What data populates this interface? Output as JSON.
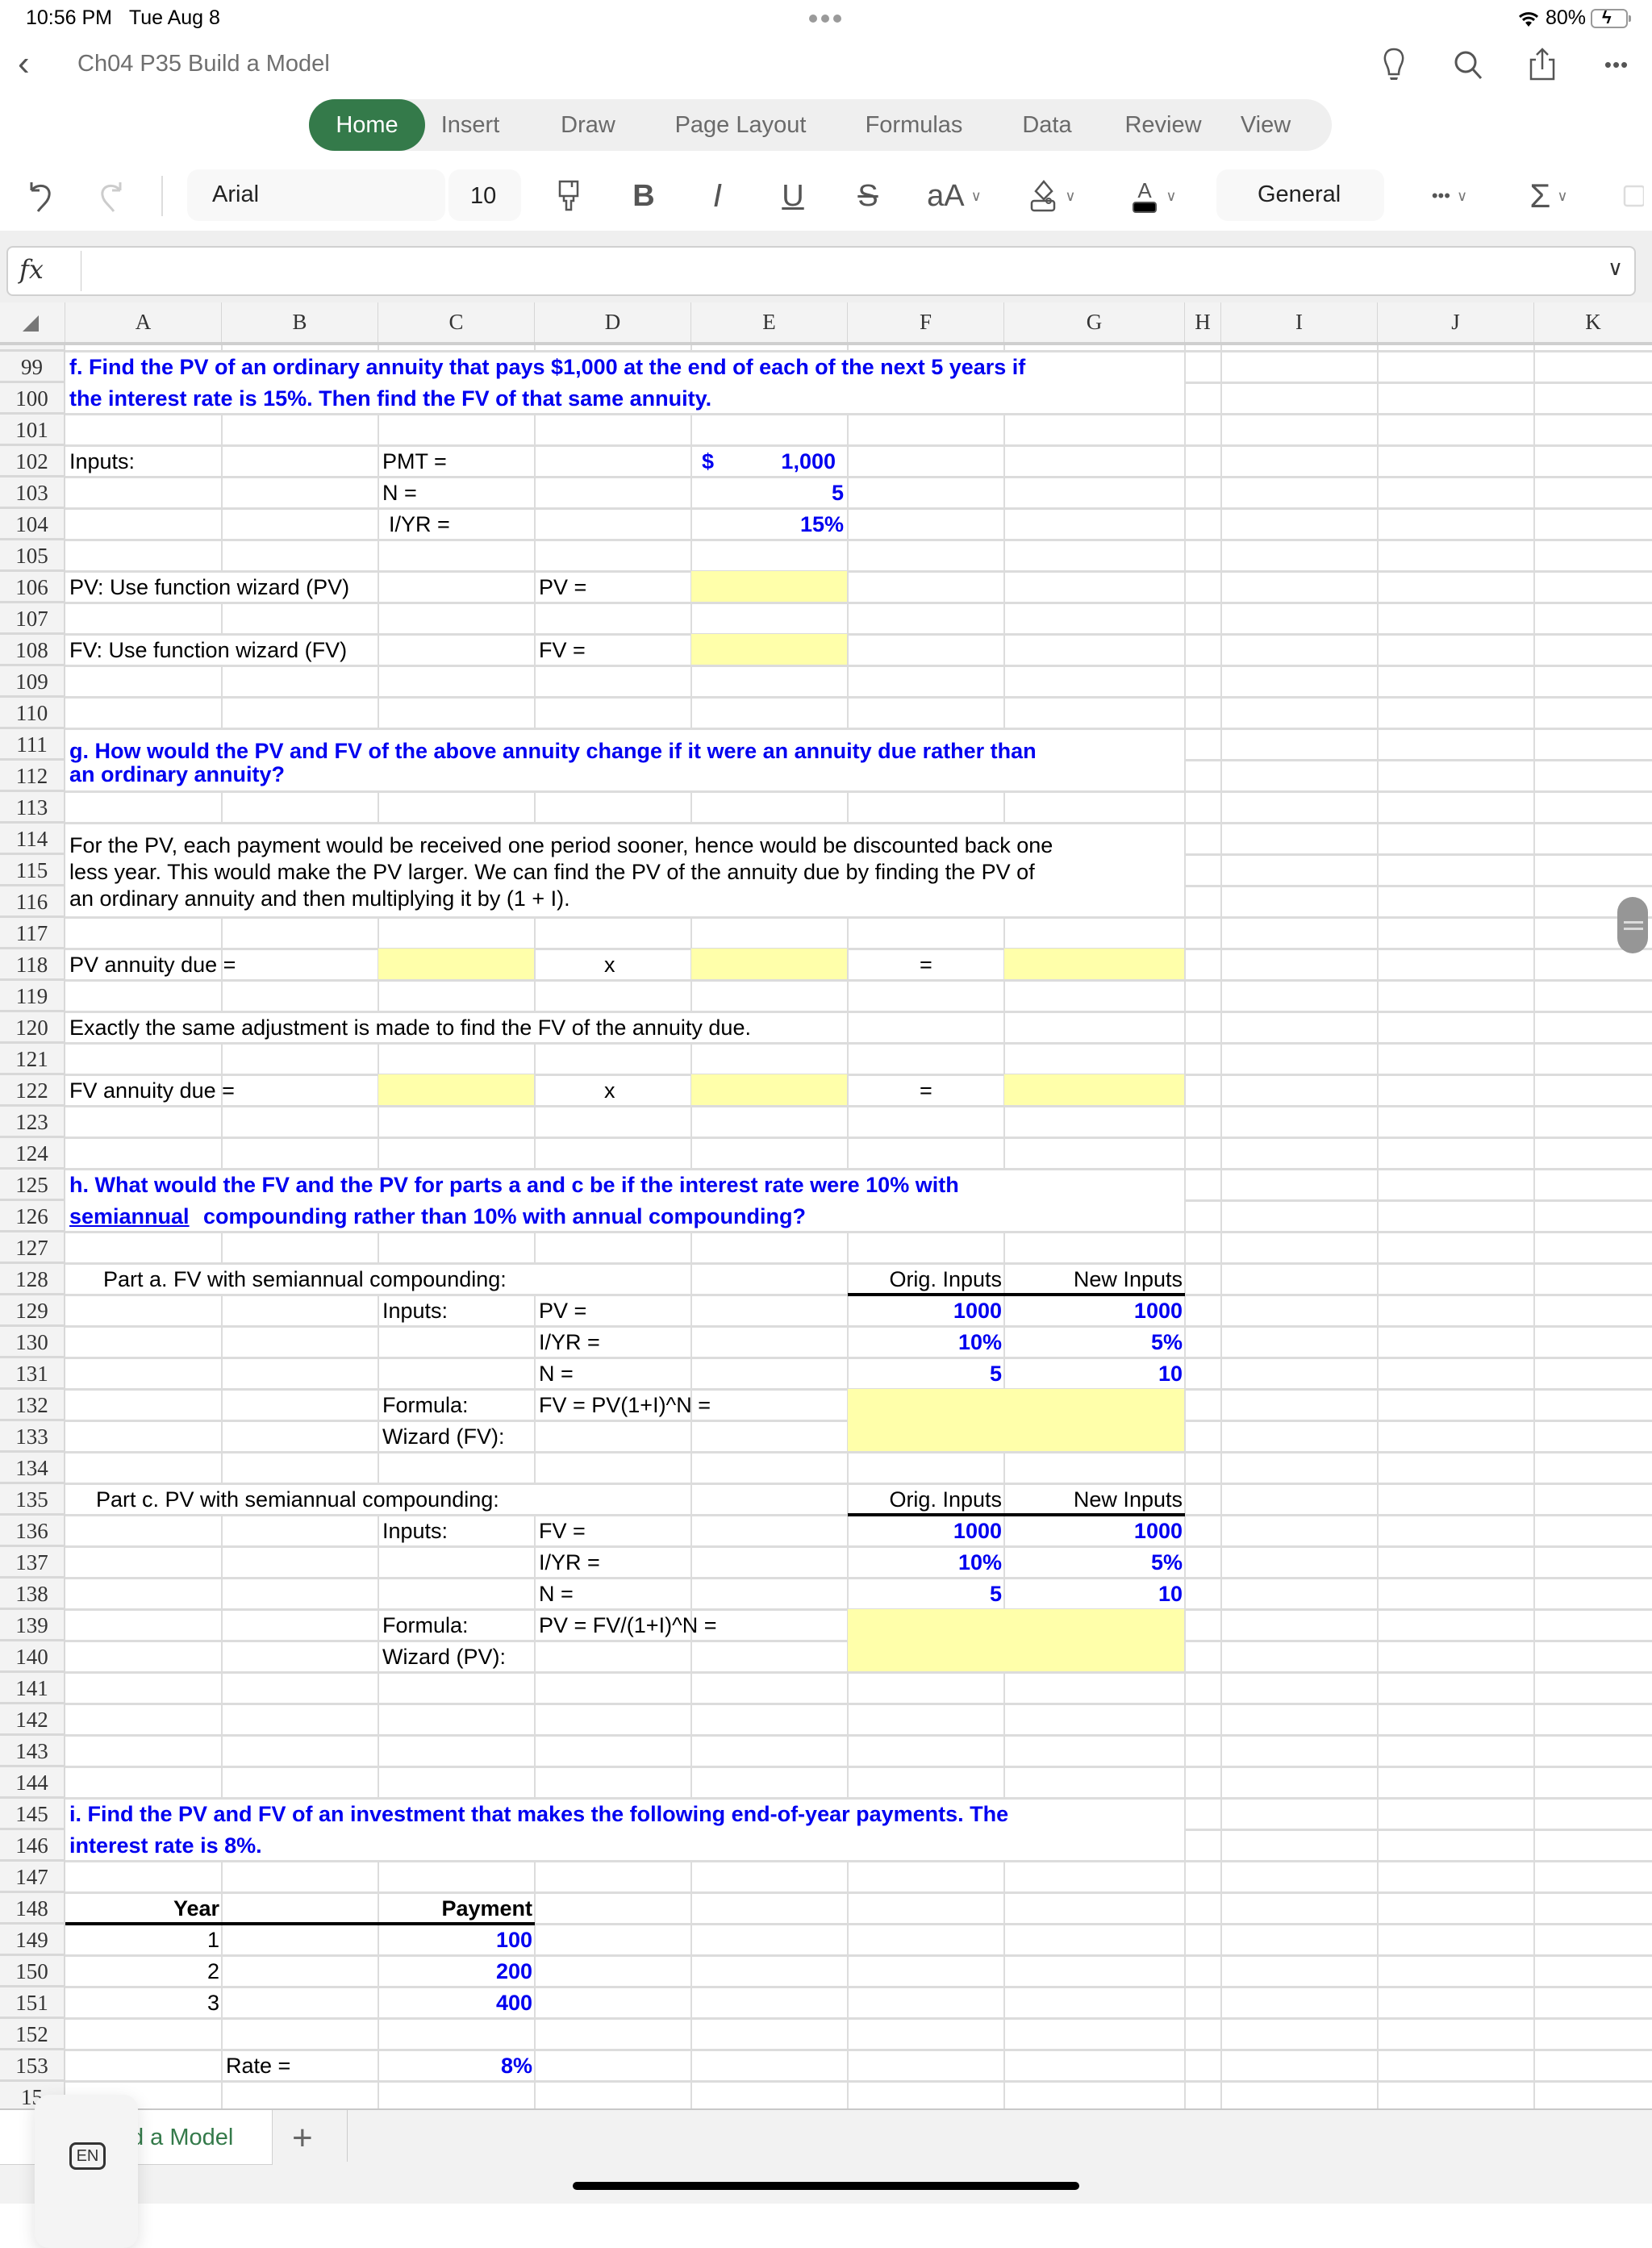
{
  "status_bar": {
    "time": "10:56 PM",
    "date": "Tue Aug 8",
    "battery": "80%"
  },
  "titlebar": {
    "title": "Ch04 P35 Build a Model"
  },
  "ribbon": {
    "tabs": [
      "Home",
      "Insert",
      "Draw",
      "Page Layout",
      "Formulas",
      "Data",
      "Review",
      "View"
    ],
    "active": "Home"
  },
  "toolbar": {
    "font_name": "Arial",
    "font_size": "10",
    "number_format": "General",
    "bold": "B",
    "italic": "I",
    "underline": "U",
    "strike": "S",
    "font_size_label": "aA",
    "sum": "Σ",
    "more": "•••"
  },
  "formula_bar": {
    "fx": "fx",
    "value": ""
  },
  "columns": [
    "A",
    "B",
    "C",
    "D",
    "E",
    "F",
    "G",
    "H",
    "I",
    "J",
    "K"
  ],
  "rows": [
    "99",
    "100",
    "101",
    "102",
    "103",
    "104",
    "105",
    "106",
    "107",
    "108",
    "109",
    "110",
    "111",
    "112",
    "113",
    "114",
    "115",
    "116",
    "117",
    "118",
    "119",
    "120",
    "121",
    "122",
    "123",
    "124",
    "125",
    "126",
    "127",
    "128",
    "129",
    "130",
    "131",
    "132",
    "133",
    "134",
    "135",
    "136",
    "137",
    "138",
    "139",
    "140",
    "141",
    "142",
    "143",
    "144",
    "145",
    "146",
    "147",
    "148",
    "149",
    "150",
    "151",
    "152",
    "153",
    "15"
  ],
  "sheet": {
    "f": {
      "line1": "f.  Find the PV of an ordinary annuity that pays $1,000 at the end of each of the next 5 years if",
      "line2": "the interest rate is 15%.  Then find the FV of that same annuity.",
      "inputs_label": "Inputs:",
      "pmt_label": "PMT =",
      "n_label": "N =",
      "iyr_label": "I/YR  =",
      "pmt_currency": "$",
      "pmt_value": "1,000",
      "n_value": "5",
      "iyr_value": "15%",
      "pv_desc": "PV:  Use function wizard (PV)",
      "pv_label": "PV  =",
      "fv_desc": "FV:  Use function wizard (FV)",
      "fv_label": "FV  ="
    },
    "g": {
      "line1": "g.  How would the PV and FV of the above annuity change if it were an annuity due rather than",
      "line2": "an ordinary annuity?",
      "para1": "For the PV, each payment would be received one period sooner, hence would be discounted back one",
      "para2": "less year.  This would make the PV larger.  We can find the PV of the annuity due by finding the PV of",
      "para3": "an ordinary annuity and then multiplying it by (1 + I).",
      "pv_due_label": "PV annuity due  =",
      "times": "x",
      "equals": "=",
      "fv_text": "Exactly the same adjustment is made to find the FV of the annuity due.",
      "fv_due_label": "FV annuity due  ="
    },
    "h": {
      "line1": "h.  What would the FV and the PV for parts a and c be if the interest rate were 10% with",
      "line2_underlined": "semiannual",
      "line2_rest": " compounding rather than 10% with annual compounding?",
      "part_a": {
        "title": "Part a.  FV with semiannual compounding:",
        "orig_header": "Orig. Inputs",
        "new_header": "New Inputs",
        "inputs_label": "Inputs:",
        "labels": [
          "PV  =",
          "I/YR  =",
          "N  ="
        ],
        "orig": [
          "1000",
          "10%",
          "5"
        ],
        "new": [
          "1000",
          "5%",
          "10"
        ],
        "formula_label": "Formula:",
        "formula": "FV = PV(1+I)^N =",
        "wizard_label": "Wizard (FV):"
      },
      "part_c": {
        "title": "Part c.  PV with semiannual compounding:",
        "orig_header": "Orig. Inputs",
        "new_header": "New Inputs",
        "inputs_label": "Inputs:",
        "labels": [
          "FV  =",
          "I/YR  =",
          "N  ="
        ],
        "orig": [
          "1000",
          "10%",
          "5"
        ],
        "new": [
          "1000",
          "5%",
          "10"
        ],
        "formula_label": "Formula:",
        "formula": "PV = FV/(1+I)^N =",
        "wizard_label": "Wizard (PV):"
      }
    },
    "i": {
      "line1": "i.  Find the PV and FV of an investment that makes the following end-of-year payments.  The",
      "line2": "interest rate is 8%.",
      "year_header": "Year",
      "payment_header": "Payment",
      "years": [
        "1",
        "2",
        "3"
      ],
      "payments": [
        "100",
        "200",
        "400"
      ],
      "rate_label": "Rate   =",
      "rate_value": "8%"
    }
  },
  "sheet_tabs": {
    "active_label": "d a Model",
    "add": "+",
    "keyboard_lang": "EN"
  },
  "colors": {
    "accent_green": "#347a4a",
    "input_blue": "#0000f0",
    "highlight_yellow": "#ffffaa"
  }
}
